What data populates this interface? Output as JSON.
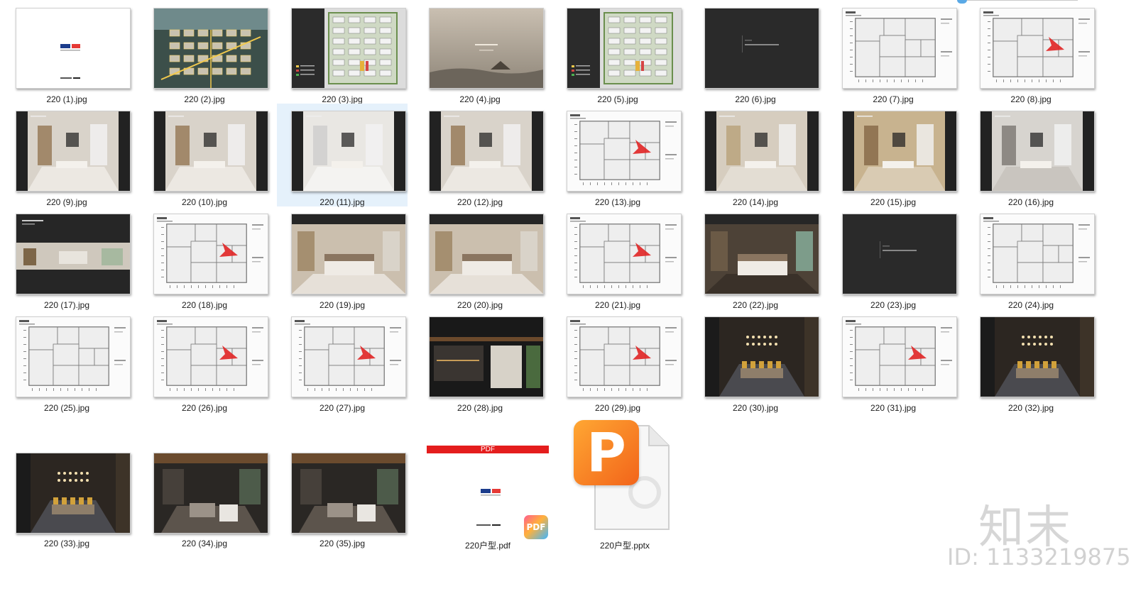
{
  "files": [
    {
      "name": "220 (1).jpg",
      "kind": "cover"
    },
    {
      "name": "220 (2).jpg",
      "kind": "aerial"
    },
    {
      "name": "220 (3).jpg",
      "kind": "siteplan"
    },
    {
      "name": "220 (4).jpg",
      "kind": "foggy"
    },
    {
      "name": "220 (5).jpg",
      "kind": "siteplan"
    },
    {
      "name": "220 (6).jpg",
      "kind": "dark"
    },
    {
      "name": "220 (7).jpg",
      "kind": "plan"
    },
    {
      "name": "220 (8).jpg",
      "kind": "plan-red"
    },
    {
      "name": "220 (9).jpg",
      "kind": "interior-living"
    },
    {
      "name": "220 (10).jpg",
      "kind": "interior-shelf"
    },
    {
      "name": "220 (11).jpg",
      "kind": "interior-white",
      "selected": true
    },
    {
      "name": "220 (12).jpg",
      "kind": "interior-living"
    },
    {
      "name": "220 (13).jpg",
      "kind": "plan-red"
    },
    {
      "name": "220 (14).jpg",
      "kind": "interior-sofa"
    },
    {
      "name": "220 (15).jpg",
      "kind": "interior-warm"
    },
    {
      "name": "220 (16).jpg",
      "kind": "interior-dining"
    },
    {
      "name": "220 (17).jpg",
      "kind": "panorama"
    },
    {
      "name": "220 (18).jpg",
      "kind": "plan-red"
    },
    {
      "name": "220 (19).jpg",
      "kind": "bedroom"
    },
    {
      "name": "220 (20).jpg",
      "kind": "bedroom"
    },
    {
      "name": "220 (21).jpg",
      "kind": "plan-red"
    },
    {
      "name": "220 (22).jpg",
      "kind": "bedroom-dark"
    },
    {
      "name": "220 (23).jpg",
      "kind": "dark"
    },
    {
      "name": "220 (24).jpg",
      "kind": "plan"
    },
    {
      "name": "220 (25).jpg",
      "kind": "plan"
    },
    {
      "name": "220 (26).jpg",
      "kind": "plan-red"
    },
    {
      "name": "220 (27).jpg",
      "kind": "plan-red"
    },
    {
      "name": "220 (28).jpg",
      "kind": "showroom"
    },
    {
      "name": "220 (29).jpg",
      "kind": "plan-red"
    },
    {
      "name": "220 (30).jpg",
      "kind": "dining-dark"
    },
    {
      "name": "220 (31).jpg",
      "kind": "plan-red"
    },
    {
      "name": "220 (32).jpg",
      "kind": "dining-dark"
    },
    {
      "name": "220 (33).jpg",
      "kind": "dining-dark"
    },
    {
      "name": "220 (34).jpg",
      "kind": "lounge-dark"
    },
    {
      "name": "220 (35).jpg",
      "kind": "lounge-dark"
    },
    {
      "name": "220户型.pdf",
      "kind": "pdf",
      "pdf_bar": "PDF",
      "badge": "PDF",
      "logo": "SUNAC"
    },
    {
      "name": "220户型.pptx",
      "kind": "pptx",
      "letter": "P"
    }
  ],
  "cover_logo": "SUNAC",
  "watermark": {
    "logo": "知末",
    "id": "ID: 1133219875"
  },
  "colors": {
    "selection": "#e5f1fb",
    "pdf_red": "#e41d1d",
    "pptx_orange": "#f57c1f"
  }
}
